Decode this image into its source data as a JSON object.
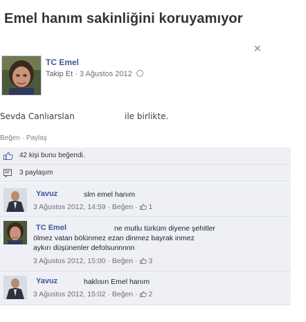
{
  "headline": "Emel hanım sakinliğini koruyamıyor",
  "post": {
    "author": "TC Emel",
    "follow_label": "Takip Et",
    "separator": "·",
    "date": "3 Ağustos 2012",
    "tagged_name": "Sevda Canlıarslan",
    "with_text": "ile birlikte.",
    "like_action": "Beğen",
    "share_action": "Paylaş",
    "likes_text": "42 kişi bunu beğendi.",
    "shares_text": "3 paylaşım"
  },
  "comments": [
    {
      "author": "Yavuz",
      "text": "slm emel hanım",
      "timestamp": "3 Ağustos 2012, 14:59",
      "like_label": "Beğen",
      "like_count": "1"
    },
    {
      "author": "TC Emel",
      "text_line1": "ne mutlu türküm diyene şehitler",
      "text_line2": "ölmez vatan bölünmez ezan dinmez bayrak inmez",
      "text_line3": "aykırı düşünenler defolsunnnnn",
      "timestamp": "3 Ağustos 2012, 15:00",
      "like_label": "Beğen",
      "like_count": "3"
    },
    {
      "author": "Yavuz",
      "text": "haklısın Emel hanım",
      "timestamp": "3 Ağustos 2012, 15:02",
      "like_label": "Beğen",
      "like_count": "2"
    }
  ],
  "colors": {
    "link": "#3b5998",
    "feedback_bg": "#eef0f5",
    "muted": "#6d6f73"
  }
}
